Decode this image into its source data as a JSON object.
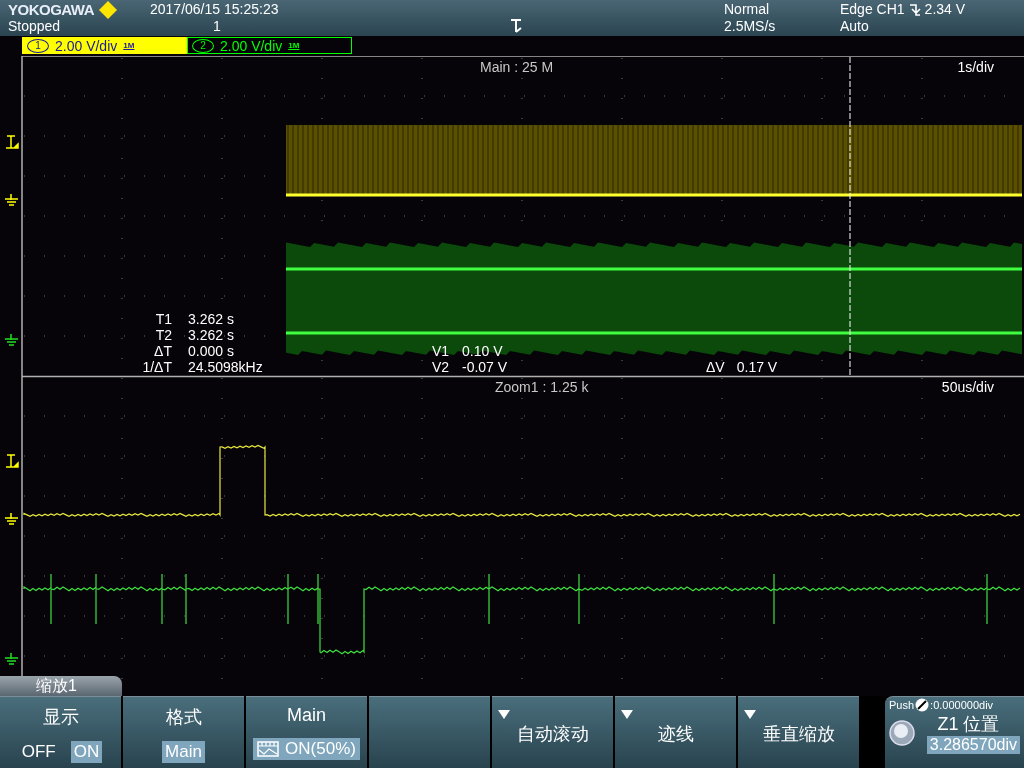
{
  "header": {
    "brand": "YOKOGAWA",
    "datetime": "2017/06/15 15:25:23",
    "run_state": "Stopped",
    "acq_count": "1",
    "acq_mode": "Normal",
    "sample_rate": "2.5MS/s",
    "trigger_type": "Edge CH1",
    "trigger_level": "2.34 V",
    "trigger_mode": "Auto"
  },
  "channels": [
    {
      "number": "1",
      "scale": "2.00 V/div",
      "impedance": "1M",
      "selected": true,
      "color": "#ffff00"
    },
    {
      "number": "2",
      "scale": "2.00 V/div",
      "impedance": "1M",
      "selected": false,
      "color": "#00ff00"
    }
  ],
  "main_window": {
    "label": "Main : 25 M",
    "timebase": "1s/div",
    "time_cursors": [
      {
        "label": "T1",
        "value": "3.262 s"
      },
      {
        "label": "T2",
        "value": "3.262 s"
      },
      {
        "label": "ΔT",
        "value": "0.000 s"
      },
      {
        "label": "1/ΔT",
        "value": "24.5098kHz"
      }
    ],
    "volt_cursors": [
      {
        "label": "V1",
        "value": "0.10 V"
      },
      {
        "label": "V2",
        "value": "-0.07 V"
      }
    ],
    "delta_v": {
      "label": "ΔV",
      "value": "0.17 V"
    }
  },
  "zoom_window": {
    "label": "Zoom1 : 1.25 k",
    "timebase": "50us/div"
  },
  "menu": {
    "title": "缩放1",
    "softkeys": [
      {
        "kind": "toggle",
        "label": "显示",
        "options": [
          {
            "label": "OFF",
            "selected": false
          },
          {
            "label": "ON",
            "selected": true
          }
        ]
      },
      {
        "kind": "value",
        "label": "格式",
        "value": "Main"
      },
      {
        "kind": "icon_value",
        "label": "Main",
        "value": "ON(50%)"
      },
      {
        "kind": "empty"
      },
      {
        "kind": "dropdown",
        "label": "自动滚动"
      },
      {
        "kind": "dropdown",
        "label": "迹线"
      },
      {
        "kind": "dropdown",
        "label": "垂直缩放"
      }
    ]
  },
  "knob": {
    "push": "Push",
    "push_value": ":0.000000div",
    "title": "Z1 位置",
    "value": "3.286570div"
  }
}
